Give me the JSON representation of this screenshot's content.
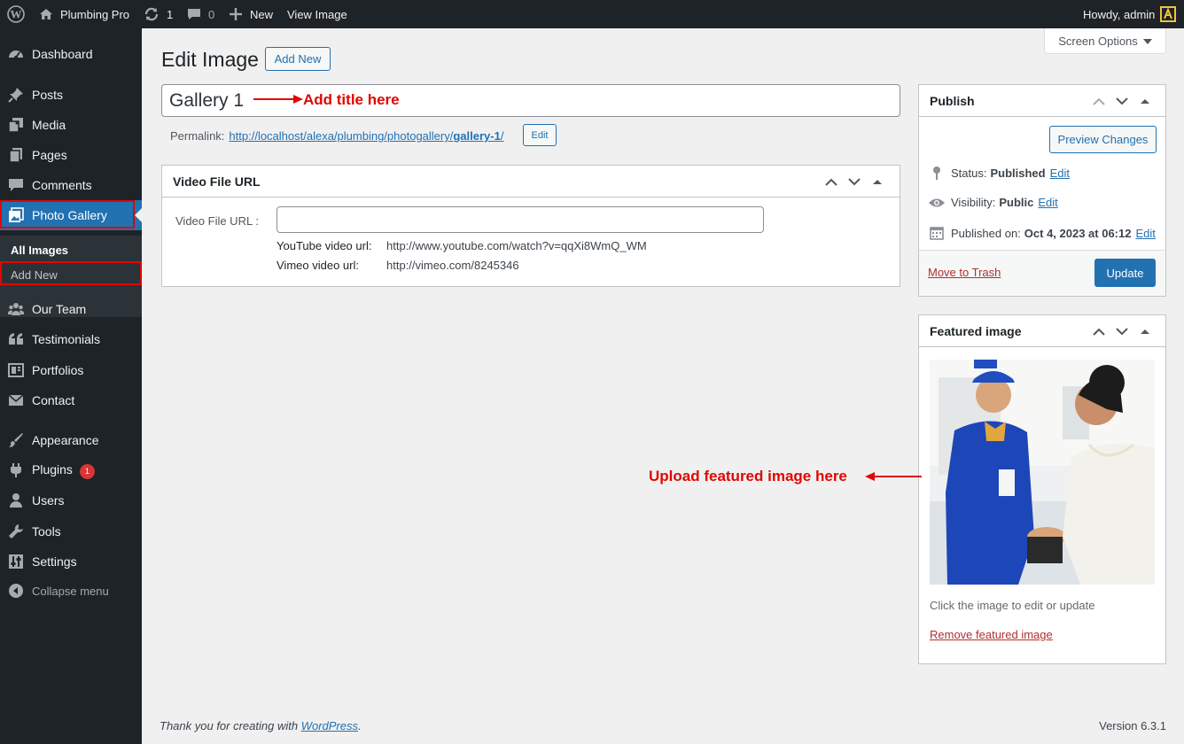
{
  "adminbar": {
    "site_name": "Plumbing Pro",
    "updates_count": "1",
    "comments_count": "0",
    "new_label": "New",
    "view_label": "View Image",
    "howdy": "Howdy, admin"
  },
  "sidebar": {
    "items": [
      {
        "label": "Dashboard",
        "icon": "dashboard-icon"
      },
      {
        "label": "Posts",
        "icon": "pin-icon"
      },
      {
        "label": "Media",
        "icon": "media-icon"
      },
      {
        "label": "Pages",
        "icon": "pages-icon"
      },
      {
        "label": "Comments",
        "icon": "comment-icon"
      },
      {
        "label": "Photo Gallery",
        "icon": "gallery-icon"
      },
      {
        "label": "Our Team",
        "icon": "groups-icon"
      },
      {
        "label": "Testimonials",
        "icon": "quote-icon"
      },
      {
        "label": "Portfolios",
        "icon": "portfolio-icon"
      },
      {
        "label": "Contact",
        "icon": "email-icon"
      },
      {
        "label": "Appearance",
        "icon": "brush-icon"
      },
      {
        "label": "Plugins",
        "icon": "plugin-icon",
        "badge": "1"
      },
      {
        "label": "Users",
        "icon": "user-icon"
      },
      {
        "label": "Tools",
        "icon": "wrench-icon"
      },
      {
        "label": "Settings",
        "icon": "settings-icon"
      },
      {
        "label": "Collapse menu",
        "icon": "collapse-icon"
      }
    ],
    "submenu": [
      {
        "label": "All Images"
      },
      {
        "label": "Add New"
      }
    ]
  },
  "content": {
    "screen_options": "Screen Options",
    "page_title": "Edit Image",
    "add_new": "Add New",
    "title_value": "Gallery 1",
    "title_annotation": "Add title here",
    "permalink_label": "Permalink:",
    "permalink_base": "http://localhost/alexa/plumbing/photogallery/",
    "permalink_slug": "gallery-1",
    "permalink_end": "/",
    "permalink_edit": "Edit"
  },
  "video_box": {
    "heading": "Video File URL",
    "field_label": "Video File URL :",
    "field_value": "",
    "youtube_label": "YouTube video url:",
    "youtube_example": "http://www.youtube.com/watch?v=qqXi8WmQ_WM",
    "vimeo_label": "Vimeo video url:",
    "vimeo_example": "http://vimeo.com/8245346"
  },
  "publish": {
    "heading": "Publish",
    "preview": "Preview Changes",
    "status_label": "Status:",
    "status_value": "Published",
    "visibility_label": "Visibility:",
    "visibility_value": "Public",
    "published_label": "Published on:",
    "published_value": "Oct 4, 2023 at 06:12",
    "edit": "Edit",
    "trash": "Move to Trash",
    "update": "Update"
  },
  "featured": {
    "heading": "Featured image",
    "hint": "Click the image to edit or update",
    "remove": "Remove featured image",
    "annotation": "Upload featured image here"
  },
  "footer": {
    "thanks_prefix": "Thank you for creating with ",
    "wordpress": "WordPress",
    "thanks_suffix": ".",
    "version": "Version 6.3.1"
  },
  "colors": {
    "accent": "#2271b1",
    "annotation_red": "#e10600",
    "sidebar_bg": "#1d2327",
    "danger": "#b32d2e"
  }
}
